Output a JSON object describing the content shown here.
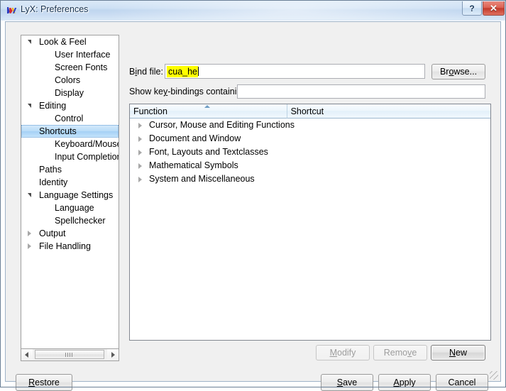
{
  "window": {
    "title": "LyX: Preferences",
    "icon": "lyx-logo-icon",
    "caption_buttons": [
      {
        "name": "help-button",
        "glyph": "?"
      },
      {
        "name": "close-button",
        "glyph": "✕"
      }
    ]
  },
  "sidebar": {
    "items": [
      {
        "label": "Look & Feel",
        "level": 0,
        "state": "expanded",
        "selected": false
      },
      {
        "label": "User Interface",
        "level": 1,
        "state": "leaf",
        "selected": false
      },
      {
        "label": "Screen Fonts",
        "level": 1,
        "state": "leaf",
        "selected": false
      },
      {
        "label": "Colors",
        "level": 1,
        "state": "leaf",
        "selected": false
      },
      {
        "label": "Display",
        "level": 1,
        "state": "leaf",
        "selected": false
      },
      {
        "label": "Editing",
        "level": 0,
        "state": "expanded",
        "selected": false
      },
      {
        "label": "Control",
        "level": 1,
        "state": "leaf",
        "selected": false
      },
      {
        "label": "Shortcuts",
        "level": 1,
        "state": "leaf",
        "selected": true
      },
      {
        "label": "Keyboard/Mouse",
        "level": 1,
        "state": "leaf",
        "selected": false
      },
      {
        "label": "Input Completion",
        "level": 1,
        "state": "leaf",
        "selected": false
      },
      {
        "label": "Paths",
        "level": 0,
        "state": "leaf",
        "selected": false
      },
      {
        "label": "Identity",
        "level": 0,
        "state": "leaf",
        "selected": false
      },
      {
        "label": "Language Settings",
        "level": 0,
        "state": "expanded",
        "selected": false
      },
      {
        "label": "Language",
        "level": 1,
        "state": "leaf",
        "selected": false
      },
      {
        "label": "Spellchecker",
        "level": 1,
        "state": "leaf",
        "selected": false
      },
      {
        "label": "Output",
        "level": 0,
        "state": "collapsed",
        "selected": false
      },
      {
        "label": "File Handling",
        "level": 0,
        "state": "collapsed",
        "selected": false
      }
    ],
    "scrollbar": {
      "left_arrow": "◄",
      "right_arrow": "►"
    }
  },
  "form": {
    "bind_file": {
      "label_pre": "B",
      "label_accel": "i",
      "label_post": "nd file:",
      "value": "cua_he",
      "value_highlighted": true,
      "highlight_color": "#ffff00"
    },
    "browse_button": {
      "label_pre": "Br",
      "label_accel": "o",
      "label_post": "wse..."
    },
    "filter": {
      "label_pre": "Show ke",
      "label_accel": "y",
      "label_post": "-bindings containing:",
      "value": "",
      "placeholder": ""
    }
  },
  "table": {
    "columns": [
      {
        "label": "Function",
        "sorted": "asc"
      },
      {
        "label": "Shortcut",
        "sorted": "none"
      }
    ],
    "rows": [
      {
        "function": "Cursor, Mouse and Editing Functions",
        "shortcut": "",
        "state": "collapsed"
      },
      {
        "function": "Document and Window",
        "shortcut": "",
        "state": "collapsed"
      },
      {
        "function": "Font, Layouts and Textclasses",
        "shortcut": "",
        "state": "collapsed"
      },
      {
        "function": "Mathematical Symbols",
        "shortcut": "",
        "state": "collapsed"
      },
      {
        "function": "System and Miscellaneous",
        "shortcut": "",
        "state": "collapsed"
      }
    ]
  },
  "item_buttons": [
    {
      "name": "modify-button",
      "label_pre": "",
      "label_accel": "M",
      "label_post": "odify",
      "enabled": false
    },
    {
      "name": "remove-button",
      "label_pre": "Remo",
      "label_accel": "v",
      "label_post": "e",
      "enabled": false
    },
    {
      "name": "new-button",
      "label_pre": "",
      "label_accel": "N",
      "label_post": "ew",
      "enabled": true
    }
  ],
  "dialog_buttons": [
    {
      "name": "restore-button",
      "label_pre": "",
      "label_accel": "R",
      "label_post": "estore",
      "default": false
    },
    {
      "name": "save-button",
      "label_pre": "",
      "label_accel": "S",
      "label_post": "ave",
      "default": false
    },
    {
      "name": "apply-button",
      "label_pre": "",
      "label_accel": "A",
      "label_post": "pply",
      "default": true
    },
    {
      "name": "cancel-button",
      "label_pre": "Cancel",
      "label_accel": "",
      "label_post": "",
      "default": false
    }
  ],
  "colors": {
    "window_background": "#f0f0f0",
    "panel_background": "#ffffff",
    "selection": "#b9dcf8",
    "highlight": "#ffff00",
    "header": "#eef6fc",
    "close_button": "#c23a2b",
    "title_text": "#17324f"
  }
}
